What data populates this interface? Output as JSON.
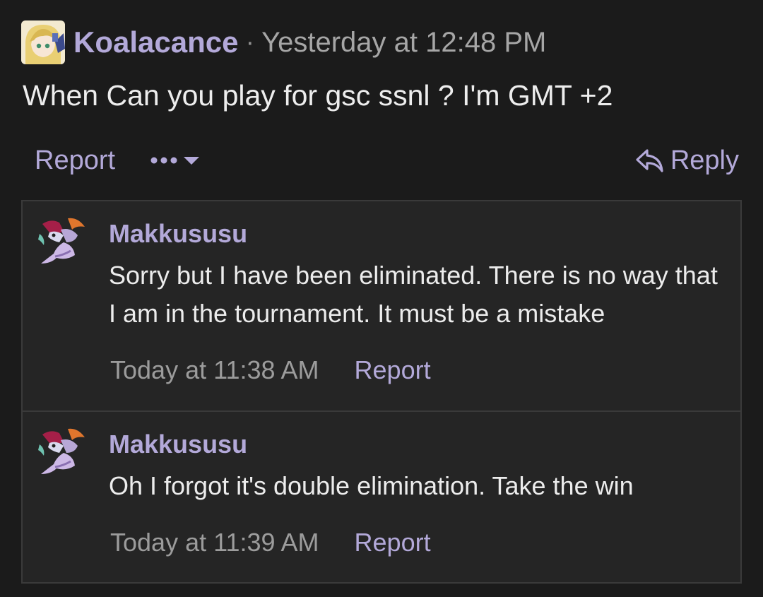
{
  "post": {
    "author": "Koalacance",
    "separator": "·",
    "timestamp": "Yesterday at 12:48 PM",
    "body": "When Can you play for gsc ssnl ? I'm GMT +2",
    "actions": {
      "report_label": "Report",
      "more_icon": "ellipsis-dropdown-icon",
      "reply_label": "Reply",
      "reply_icon": "reply-arrow-icon"
    }
  },
  "replies": [
    {
      "author": "Makkususu",
      "text": "Sorry but I have been eliminated. There is no way that I am in the tournament. It must be a mistake",
      "timestamp": "Today at 11:38 AM",
      "report_label": "Report"
    },
    {
      "author": "Makkususu",
      "text": "Oh I forgot it's double elimination. Take the win",
      "timestamp": "Today at 11:39 AM",
      "report_label": "Report"
    }
  ],
  "colors": {
    "background": "#1b1b1b",
    "reply_panel": "#252525",
    "accent": "#b3a9d9",
    "muted_text": "#a6a6a6",
    "border": "#3a3a3a"
  }
}
